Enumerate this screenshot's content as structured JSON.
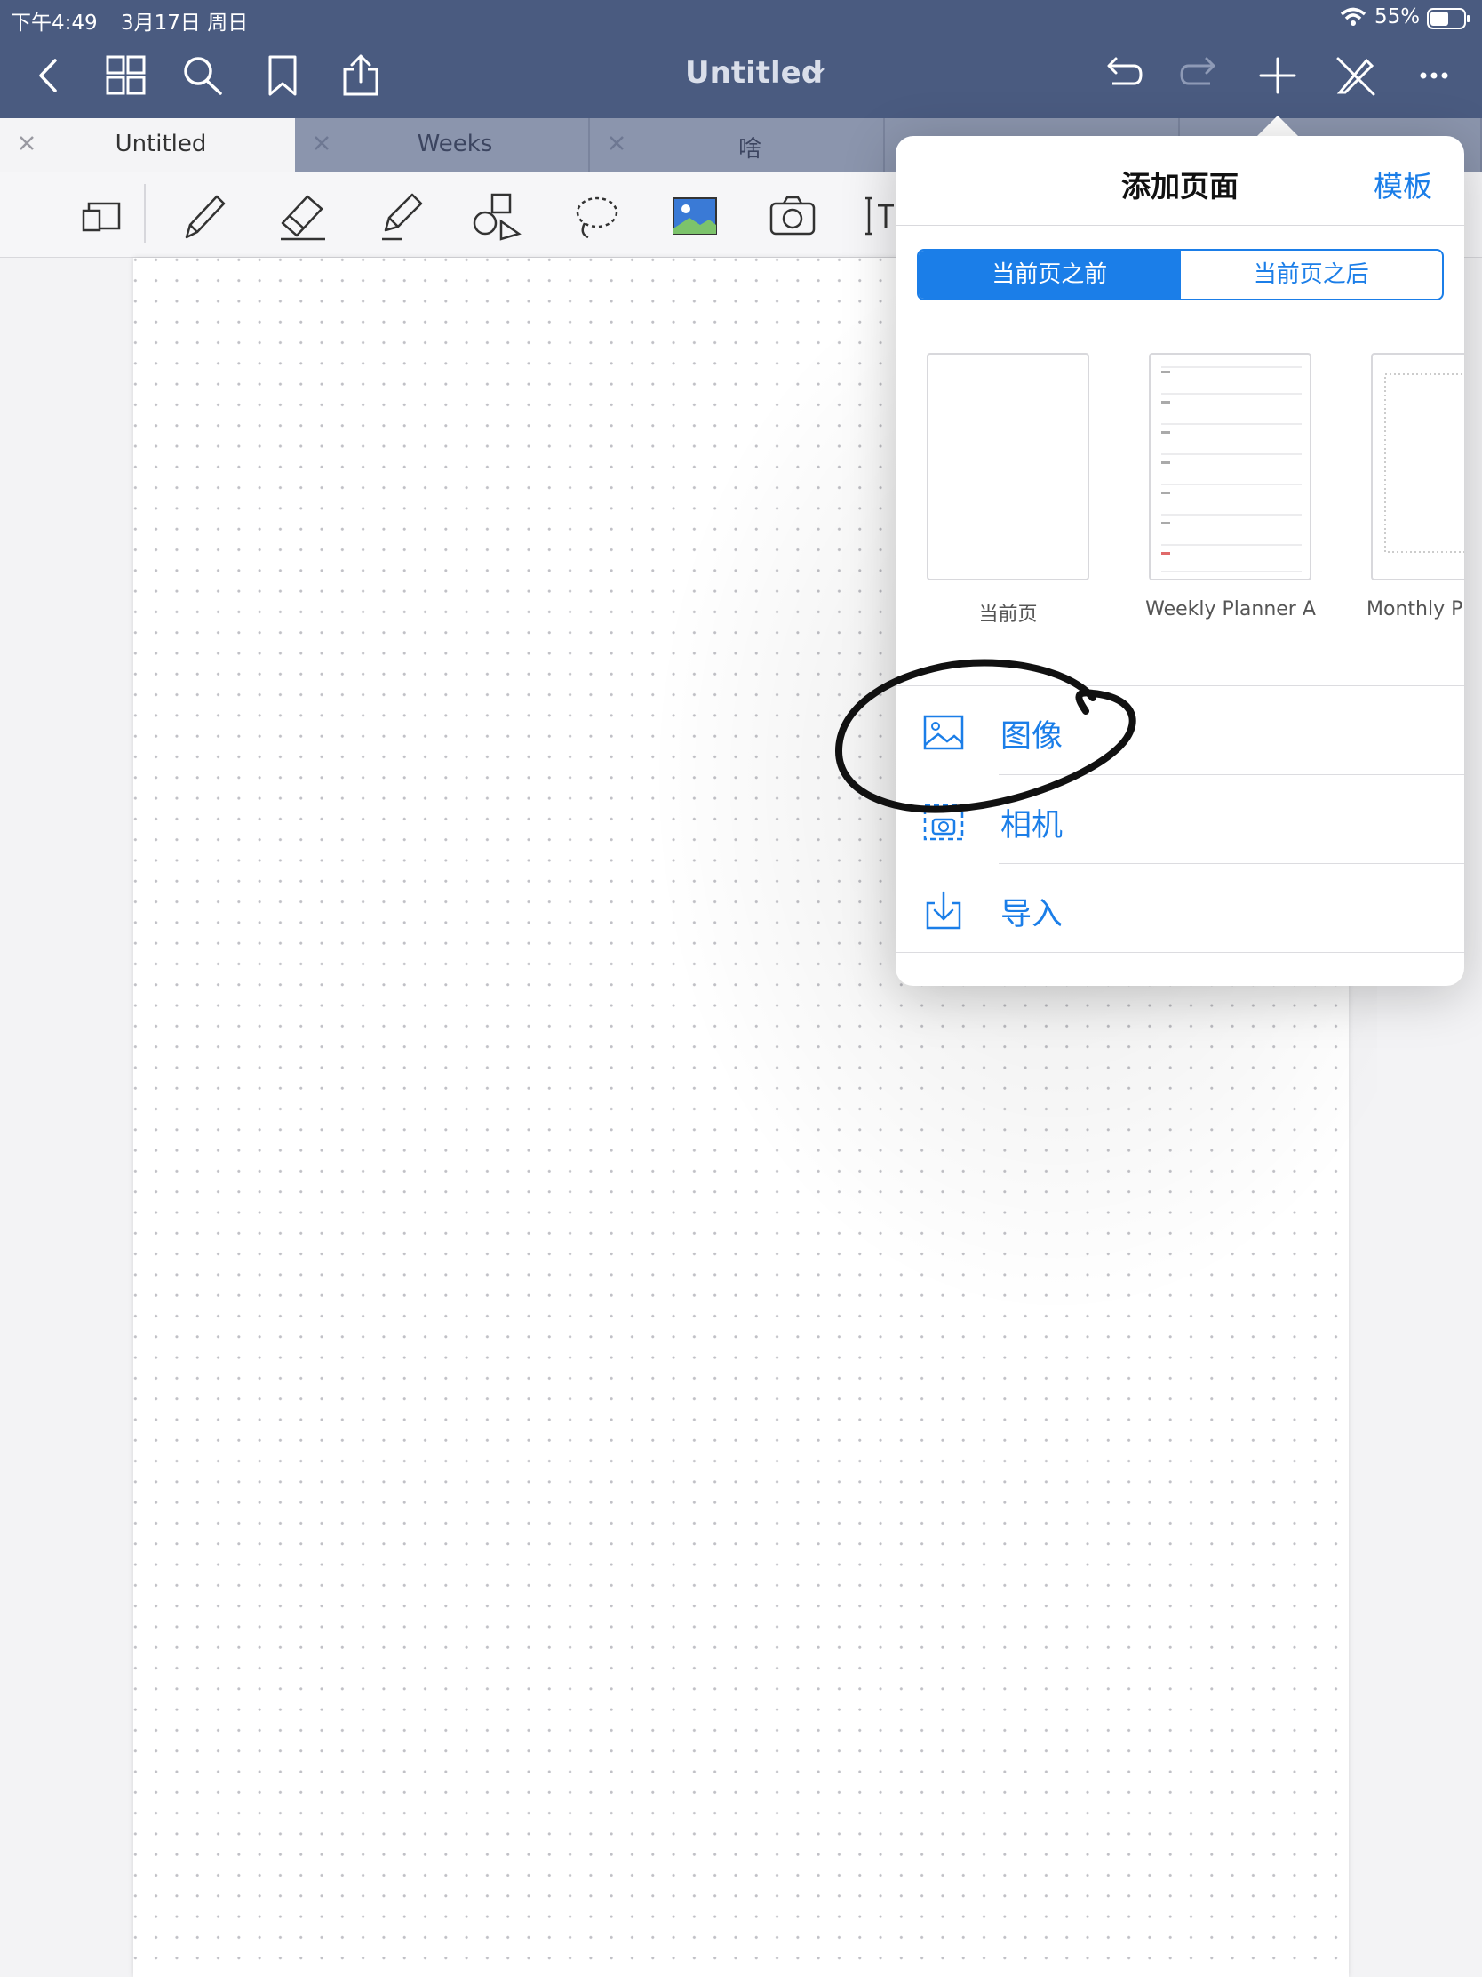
{
  "status": {
    "time": "下午4:49",
    "date": "3月17日 周日",
    "battery": "55%"
  },
  "header": {
    "title": "Untitled",
    "icons": [
      "back-icon",
      "grid-icon",
      "search-icon",
      "bookmark-icon",
      "share-icon",
      "undo-icon",
      "redo-icon",
      "add-icon",
      "pen-off-icon",
      "more-icon"
    ]
  },
  "tabs": [
    {
      "label": "Untitled",
      "active": true
    },
    {
      "label": "Weeks",
      "active": false
    },
    {
      "label": "啥",
      "active": false
    }
  ],
  "tools": [
    "read-mode-icon",
    "pen-icon",
    "eraser-icon",
    "highlighter-icon",
    "shapes-icon",
    "lasso-icon",
    "image-icon",
    "camera-icon",
    "text-icon"
  ],
  "popover": {
    "title": "添加页面",
    "templates_label": "模板",
    "segments": [
      "当前页之前",
      "当前页之后"
    ],
    "selected_segment": "当前页之前",
    "templates": [
      {
        "label": "当前页"
      },
      {
        "label": "Weekly Planner A"
      },
      {
        "label": "Monthly Pl"
      }
    ],
    "options": {
      "image": "图像",
      "camera": "相机",
      "import": "导入"
    }
  },
  "colors": {
    "header": "#4a5b80",
    "tabbar": "#8b95ad",
    "accent": "#1b7ee8"
  }
}
